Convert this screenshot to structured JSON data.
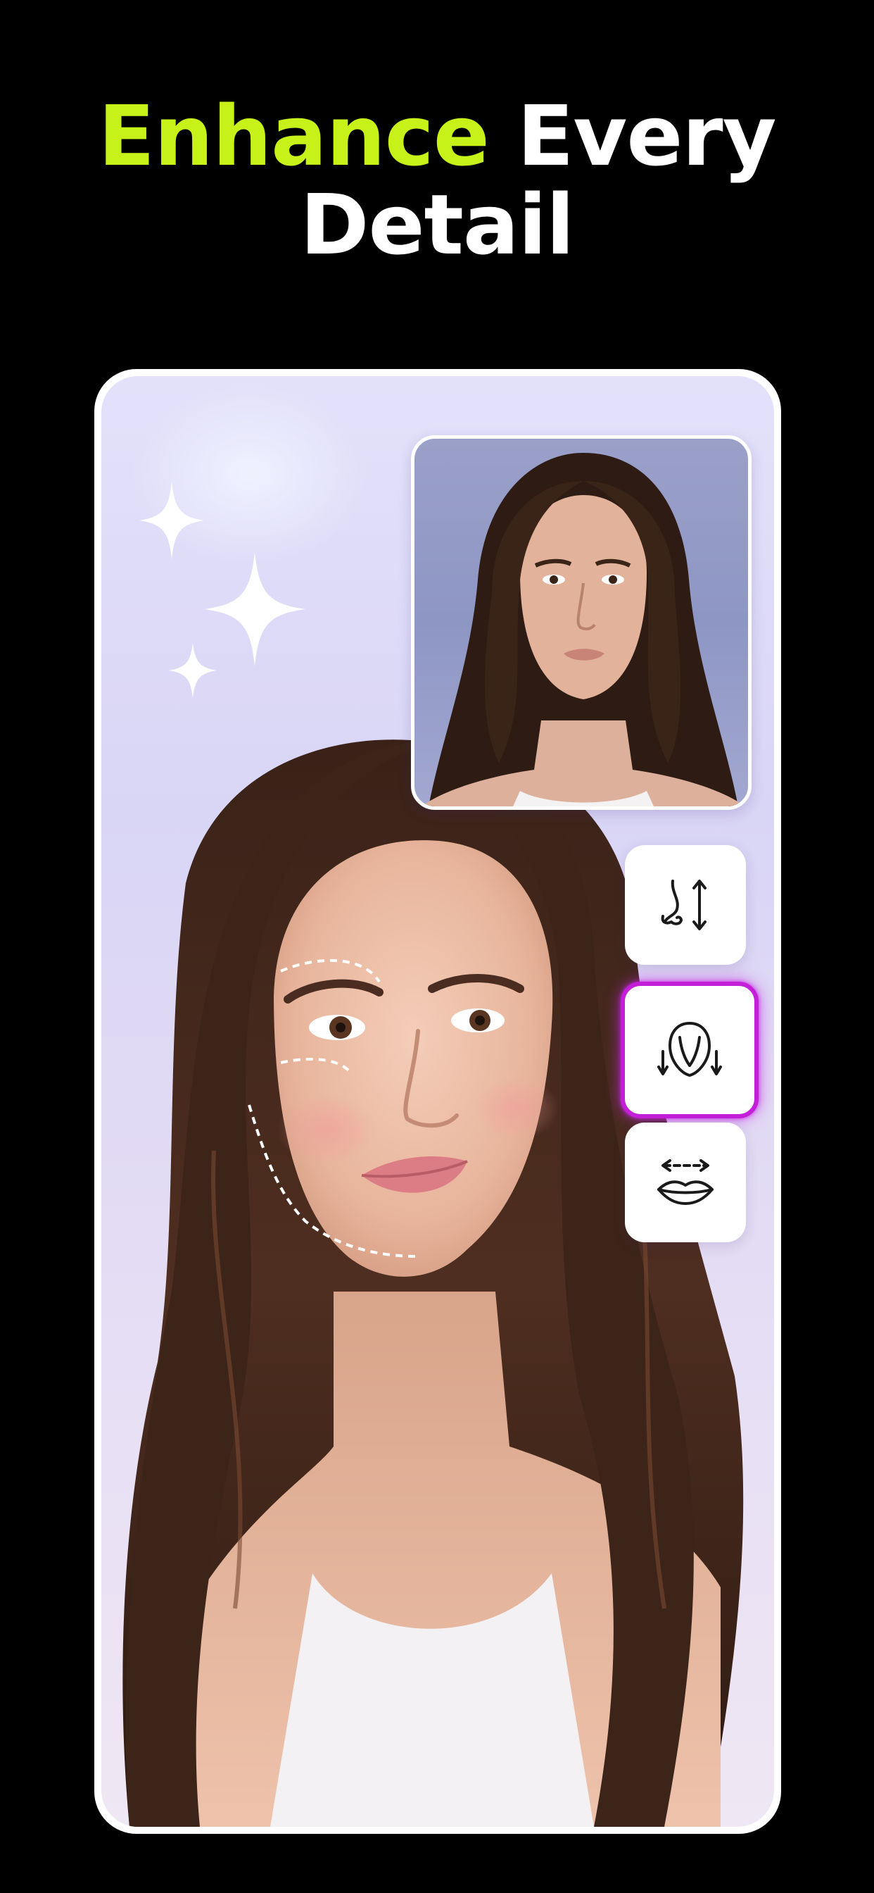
{
  "headline": {
    "accent_word": "Enhance",
    "rest_line1": "Every",
    "line2": "Detail"
  },
  "colors": {
    "accent": "#c6f21a",
    "background": "#000000",
    "highlight": "#c31ed8"
  },
  "tools": [
    {
      "icon": "nose-height-icon",
      "active": false
    },
    {
      "icon": "face-shape-icon",
      "active": true
    },
    {
      "icon": "lips-width-icon",
      "active": false
    }
  ]
}
